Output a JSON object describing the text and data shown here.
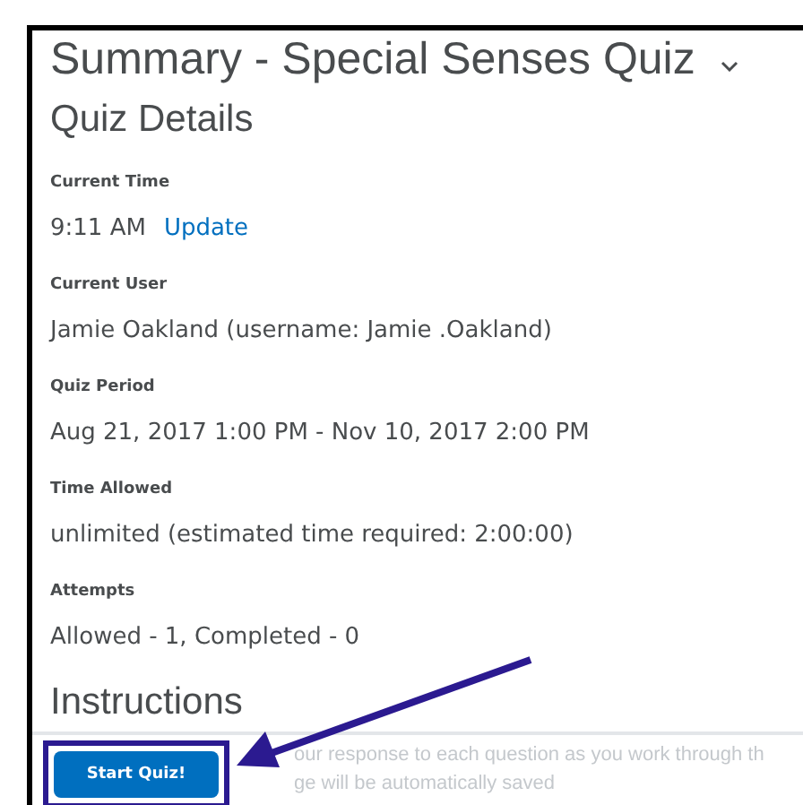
{
  "page": {
    "title": "Summary - Special Senses Quiz",
    "section": "Quiz Details"
  },
  "details": [
    {
      "label": "Current Time",
      "value": "9:11 AM",
      "link": "Update"
    },
    {
      "label": "Current User",
      "value": "Jamie Oakland (username: Jamie .Oakland)"
    },
    {
      "label": "Quiz Period",
      "value": "Aug 21, 2017 1:00 PM - Nov 10, 2017 2:00 PM"
    },
    {
      "label": "Time Allowed",
      "value": "unlimited (estimated time required: 2:00:00)"
    },
    {
      "label": "Attempts",
      "value": "Allowed - 1, Completed - 0"
    }
  ],
  "instructions": {
    "heading": "Instructions",
    "lines": [
      "our response to each question as you work through th",
      "ge will be automatically saved"
    ]
  },
  "start_button": "Start Quiz!"
}
